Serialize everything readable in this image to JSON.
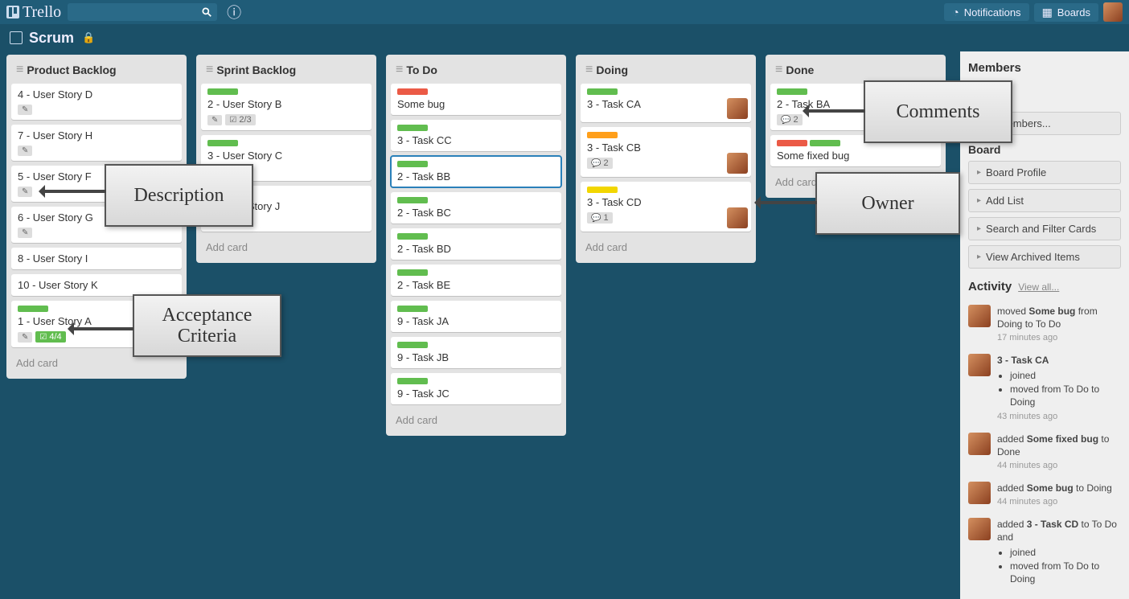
{
  "header": {
    "logo_text": "Trello",
    "search_placeholder": "",
    "notifications_label": "Notifications",
    "boards_label": "Boards"
  },
  "board": {
    "name": "Scrum"
  },
  "lists": [
    {
      "title": "Product Backlog",
      "cards": [
        {
          "title": "4 - User Story D",
          "desc": true
        },
        {
          "title": "7 - User Story H",
          "desc": true
        },
        {
          "title": "5 - User Story F",
          "desc": true
        },
        {
          "title": "6 - User Story G",
          "desc": true
        },
        {
          "title": "8 - User Story I"
        },
        {
          "title": "10 - User Story K"
        },
        {
          "title": "1 - User Story A",
          "labels": [
            "green"
          ],
          "desc": true,
          "check": "4/4",
          "check_green": true
        }
      ],
      "add": "Add card"
    },
    {
      "title": "Sprint Backlog",
      "cards": [
        {
          "title": "2 - User Story B",
          "labels": [
            "green"
          ],
          "desc": true,
          "check": "2/3"
        },
        {
          "title": "3 - User Story C",
          "labels": [
            "green"
          ],
          "desc": true
        },
        {
          "title": "9 - User Story J",
          "labels": [
            "green"
          ],
          "desc": true
        }
      ],
      "add": "Add card"
    },
    {
      "title": "To Do",
      "cards": [
        {
          "title": "Some bug",
          "labels": [
            "red"
          ]
        },
        {
          "title": "3 - Task CC",
          "labels": [
            "green"
          ]
        },
        {
          "title": "2 - Task BB",
          "labels": [
            "green"
          ],
          "highlight": true
        },
        {
          "title": "2 - Task BC",
          "labels": [
            "green"
          ]
        },
        {
          "title": "2 - Task BD",
          "labels": [
            "green"
          ]
        },
        {
          "title": "2 - Task BE",
          "labels": [
            "green"
          ]
        },
        {
          "title": "9 - Task JA",
          "labels": [
            "green"
          ]
        },
        {
          "title": "9 - Task JB",
          "labels": [
            "green"
          ]
        },
        {
          "title": "9 - Task JC",
          "labels": [
            "green"
          ]
        }
      ],
      "add": "Add card"
    },
    {
      "title": "Doing",
      "cards": [
        {
          "title": "3 - Task CA",
          "labels": [
            "green"
          ],
          "avatar": true
        },
        {
          "title": "3 - Task CB",
          "labels": [
            "orange"
          ],
          "comments": 2,
          "avatar": true
        },
        {
          "title": "3 - Task CD",
          "labels": [
            "yellow"
          ],
          "comments": 1,
          "avatar": true
        }
      ],
      "add": "Add card"
    },
    {
      "title": "Done",
      "cards": [
        {
          "title": "2 - Task BA",
          "labels": [
            "green"
          ],
          "comments": 2
        },
        {
          "title": "Some fixed bug",
          "labels": [
            "red",
            "green"
          ]
        }
      ],
      "add": "Add card"
    }
  ],
  "sidebar": {
    "members_title": "Members",
    "add_members": "Add Members...",
    "board_section": "Board",
    "links": {
      "profile": "Board Profile",
      "add_list": "Add List",
      "search": "Search and Filter Cards",
      "archived": "View Archived Items"
    },
    "activity_title": "Activity",
    "view_all": "View all...",
    "activity": [
      {
        "html": "moved <b>Some bug</b> from Doing to To Do",
        "time": "17 minutes ago"
      },
      {
        "title": "3 - Task CA",
        "bullets": [
          "joined",
          "moved from To Do to Doing"
        ],
        "time": "43 minutes ago"
      },
      {
        "html": "added <b>Some fixed bug</b> to Done",
        "time": "44 minutes ago"
      },
      {
        "html": "added <b>Some bug</b> to Doing",
        "time": "44 minutes ago"
      },
      {
        "html": "added <b>3 - Task CD</b> to To Do and",
        "bullets": [
          "joined",
          "moved from To Do to Doing"
        ],
        "time": ""
      }
    ]
  },
  "annotations": {
    "description": "Description",
    "acceptance": "Acceptance Criteria",
    "comments": "Comments",
    "owner": "Owner"
  }
}
